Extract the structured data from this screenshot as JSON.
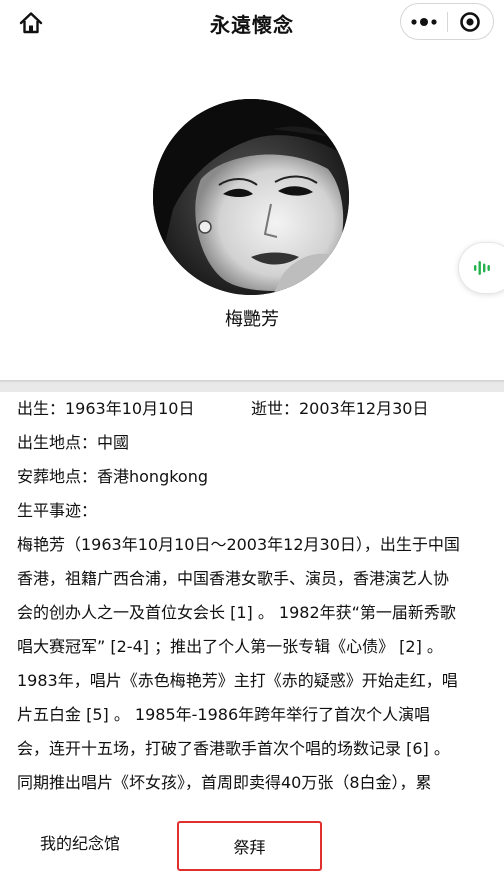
{
  "header": {
    "title": "永遠懷念",
    "home_icon": "home-icon",
    "more_icon": "more-dots-icon",
    "close_icon": "target-close-icon"
  },
  "profile": {
    "name": "梅艷芳",
    "avatar": "portrait-photo",
    "voice_icon": "voice-wave-icon",
    "accent_color": "#22b14c"
  },
  "info": {
    "birth": "出生：1963年10月10日",
    "death": "逝世：2003年12月30日",
    "birthplace": "出生地点：中國",
    "burial": "安葬地点：香港hongkong",
    "bio_heading": "生平事迹：",
    "bio_lines": [
      "梅艳芳（1963年10月10日～2003年12月30日），出生于中国",
      "香港，祖籍广西合浦，中国香港女歌手、演员，香港演艺人协",
      "会的创办人之一及首位女会长 [1] 。 1982年获“第一届新秀歌",
      "唱大赛冠军” [2-4] ；推出了个人第一张专辑《心债》 [2] 。",
      "1983年，唱片《赤色梅艳芳》主打《赤的疑惑》开始走红，唱",
      "片五白金 [5] 。 1985年-1986年跨年举行了首次个人演唱",
      "会，连开十五场，打破了香港歌手首次个唱的场数记录 [6] 。",
      "同期推出唱片《坏女孩》，首周即卖得40万张（8白金），累"
    ]
  },
  "tabbar": {
    "memorial_label": "我的纪念馆",
    "worship_label": "祭拜",
    "highlight_color": "#e0302e"
  }
}
